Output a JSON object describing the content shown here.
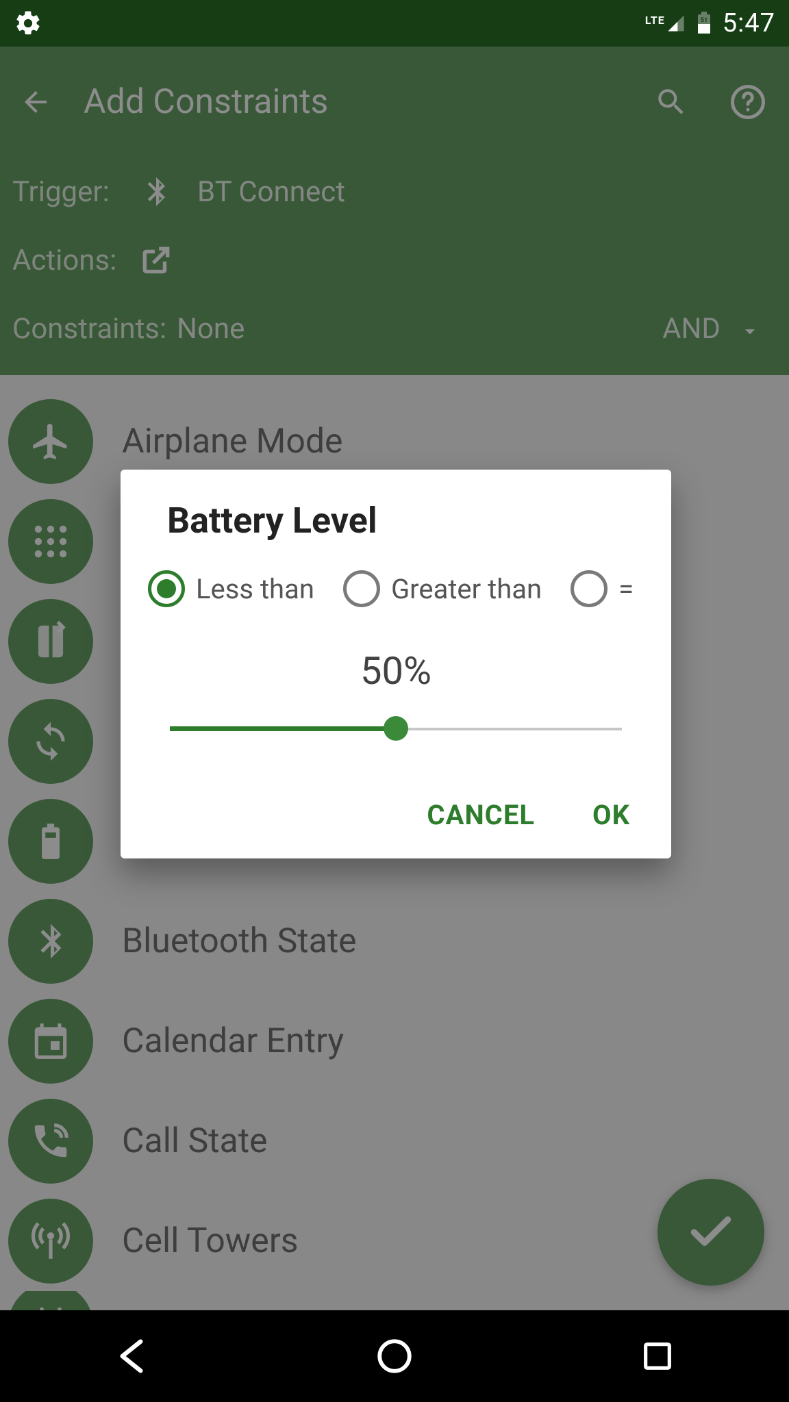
{
  "status": {
    "time": "5:47",
    "network": "LTE",
    "battery_pct": "51"
  },
  "toolbar": {
    "title": "Add Constraints"
  },
  "header": {
    "trigger_label": "Trigger:",
    "trigger_value": "BT Connect",
    "actions_label": "Actions:",
    "constraints_label": "Constraints:",
    "constraints_value": "None",
    "logic": "AND"
  },
  "list": [
    {
      "icon": "airplane-icon",
      "label": "Airplane Mode"
    },
    {
      "icon": "apps-icon",
      "label": ""
    },
    {
      "icon": "flip-icon",
      "label": ""
    },
    {
      "icon": "sync-icon",
      "label": ""
    },
    {
      "icon": "battery-icon",
      "label": ""
    },
    {
      "icon": "bluetooth-icon",
      "label": "Bluetooth State"
    },
    {
      "icon": "calendar-icon",
      "label": "Calendar Entry"
    },
    {
      "icon": "call-icon",
      "label": "Call State"
    },
    {
      "icon": "tower-icon",
      "label": "Cell Towers"
    },
    {
      "icon": "day-icon",
      "label": ""
    }
  ],
  "dialog": {
    "title": "Battery Level",
    "options": [
      {
        "label": "Less than",
        "selected": true
      },
      {
        "label": "Greater than",
        "selected": false
      },
      {
        "label": "=",
        "selected": false
      }
    ],
    "percent": "50%",
    "slider_value": 50,
    "cancel": "CANCEL",
    "ok": "OK"
  },
  "colors": {
    "primary": "#2d7d2d",
    "primary_dark": "#163d14"
  }
}
